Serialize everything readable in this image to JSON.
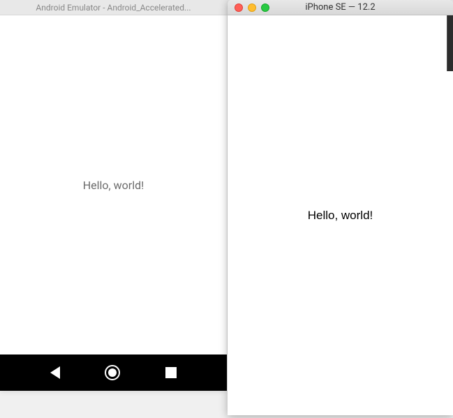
{
  "android": {
    "title": "Android Emulator - Android_Accelerated...",
    "content_text": "Hello, world!"
  },
  "ios": {
    "title": "iPhone SE — 12.2",
    "content_text": "Hello, world!"
  }
}
